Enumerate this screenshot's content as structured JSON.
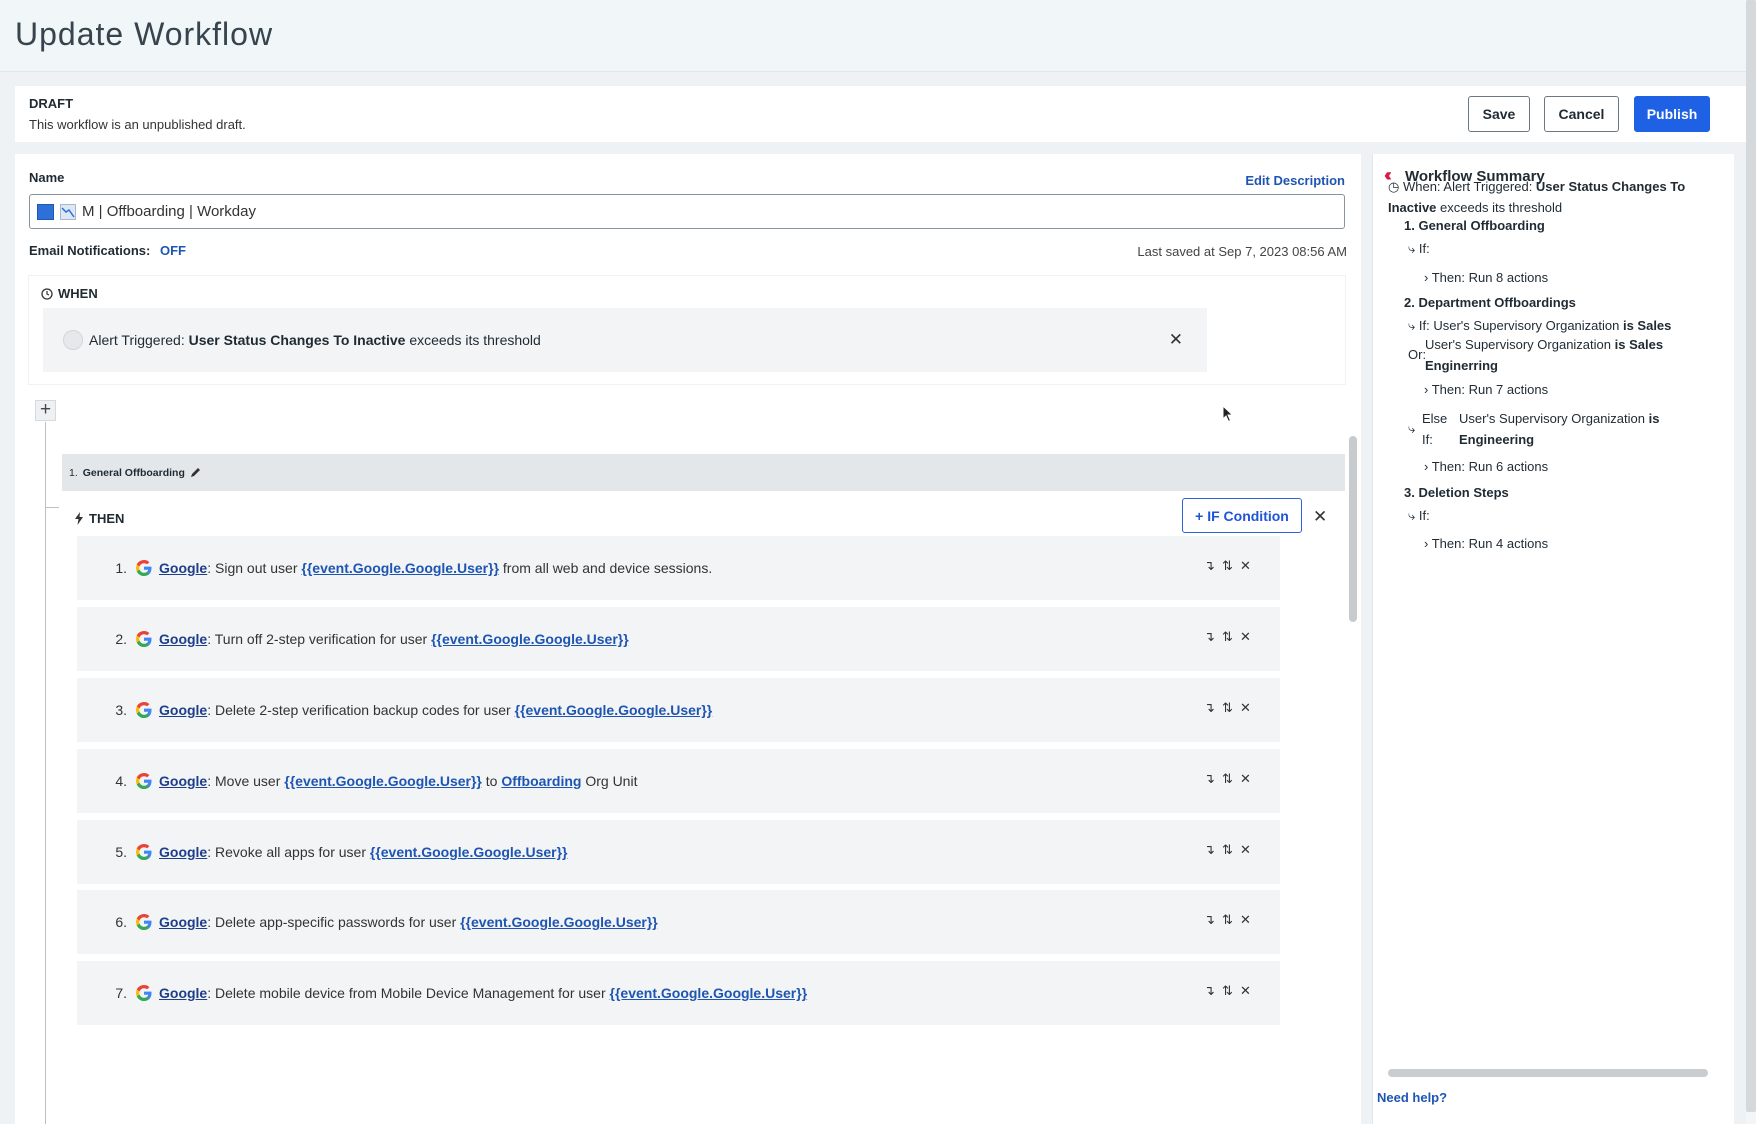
{
  "page": {
    "title": "Update Workflow"
  },
  "draft": {
    "status": "DRAFT",
    "description": "This workflow is an unpublished draft.",
    "save_label": "Save",
    "cancel_label": "Cancel",
    "publish_label": "Publish"
  },
  "form": {
    "name_label": "Name",
    "edit_description_label": "Edit Description",
    "name_value": "M | Offboarding | Workday",
    "email_label": "Email Notifications:",
    "email_value": "OFF",
    "last_saved": "Last saved at Sep 7, 2023 08:56 AM"
  },
  "when": {
    "label": "WHEN",
    "prefix": "Alert Triggered:",
    "alert_name": "User Status Changes To Inactive",
    "suffix": "exceeds its threshold"
  },
  "group1": {
    "number": "1.",
    "name": "General Offboarding",
    "then_label": "THEN",
    "if_condition_label": "+ IF Condition",
    "actions": [
      {
        "num": "1.",
        "app": "Google",
        "pre": ": Sign out user ",
        "var": "{{event.Google.Google.User}}",
        "post": " from all web and device sessions."
      },
      {
        "num": "2.",
        "app": "Google",
        "pre": ": Turn off 2-step verification for user ",
        "var": "{{event.Google.Google.User}}",
        "post": ""
      },
      {
        "num": "3.",
        "app": "Google",
        "pre": ": Delete 2-step verification backup codes for user ",
        "var": "{{event.Google.Google.User}}",
        "post": ""
      },
      {
        "num": "4.",
        "app": "Google",
        "pre": ": Move user ",
        "var": "{{event.Google.Google.User}}",
        "mid": " to ",
        "var2": "Offboarding",
        "post": " Org Unit"
      },
      {
        "num": "5.",
        "app": "Google",
        "pre": ": Revoke all apps for user ",
        "var": "{{event.Google.Google.User}}",
        "post": ""
      },
      {
        "num": "6.",
        "app": "Google",
        "pre": ": Delete app-specific passwords for user ",
        "var": "{{event.Google.Google.User}}",
        "post": ""
      },
      {
        "num": "7.",
        "app": "Google",
        "pre": ": Delete mobile device from Mobile Device Management for user ",
        "var": "{{event.Google.Google.User}}",
        "post": ""
      }
    ]
  },
  "summary": {
    "title": "Workflow Summary",
    "when_prefix": "When: Alert Triggered: ",
    "when_alert": "User Status Changes To Inactive",
    "when_suffix": " exceeds its threshold",
    "s1_title": "1. General Offboarding",
    "s1_if": "If:",
    "s1_then": "Then: Run 8 actions",
    "s2_title": "2. Department Offboardings",
    "s2_if_prefix": "If: User's Supervisory Organization ",
    "s2_if_bold": "is Sales",
    "s2_or_label": "Or:",
    "s2_or_text": "User's Supervisory Organization ",
    "s2_or_bold": "is Sales Enginerring",
    "s2_then": "Then: Run 7 actions",
    "s2_else_label": "Else If:",
    "s2_else_text": "User's Supervisory Organization ",
    "s2_else_bold": "is Engineering",
    "s2_else_then": "Then: Run 6 actions",
    "s3_title": "3. Deletion Steps",
    "s3_if": "If:",
    "s3_then": "Then: Run 4 actions",
    "need_help": "Need help?"
  }
}
